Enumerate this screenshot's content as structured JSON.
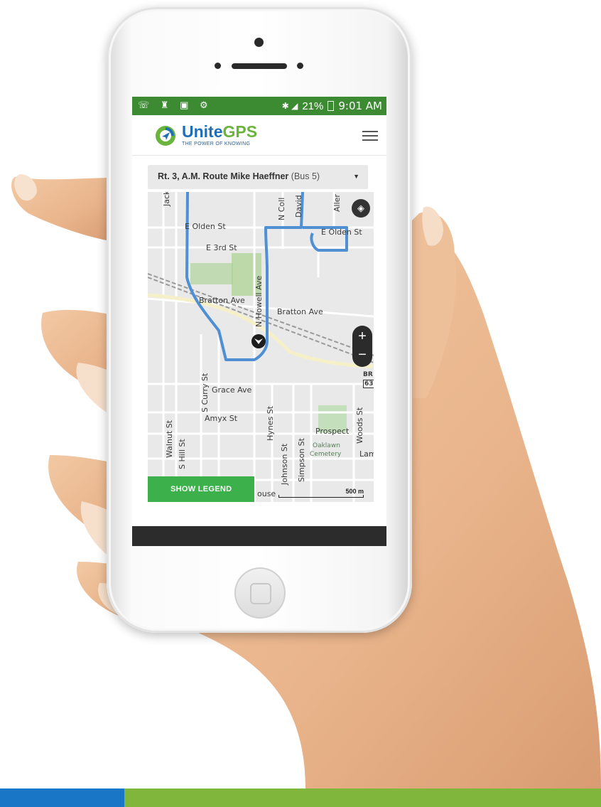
{
  "status_bar": {
    "battery": "21%",
    "time": "9:01 AM"
  },
  "header": {
    "logo_unite": "Unite",
    "logo_gps": "GPS",
    "tagline": "THE POWER OF KNOWING"
  },
  "route_selector": {
    "selected_route": "Rt. 3, A.M. Route Mike Haeffner",
    "selected_bus": "(Bus 5)"
  },
  "map": {
    "streets": {
      "e_olden_st_w": "E Olden St",
      "e_olden_st_e": "E Olden St",
      "e_3rd_st": "E 3rd St",
      "bratton_ave_w": "Bratton Ave",
      "bratton_ave_e": "Bratton Ave",
      "grace_ave": "Grace Ave",
      "amyx_st": "Amyx St",
      "prospect": "Prospect",
      "oaklawn": "Oaklawn",
      "cemetery": "Cemetery",
      "jackson": "Jackson",
      "n_coll": "N Coll",
      "david": "David",
      "aller": "Aller",
      "s_curry_st": "S Curry St",
      "walnut_st": "Walnut St",
      "s_hill_st": "S Hill St",
      "hynes_st": "Hynes St",
      "johnson_st": "Johnson St",
      "simpson_st": "Simpson St",
      "woods_st": "Woods St",
      "n_howell_ave": "N Howell Ave",
      "lam": "Lam",
      "br": "BR",
      "hwy_63": "63",
      "house": "ouse"
    },
    "zoom_in": "+",
    "zoom_out": "−",
    "scale_label": "500 m",
    "legend_button": "SHOW LEGEND",
    "route_color": "#4f8fd4"
  },
  "brand_colors": {
    "blue": "#1976c6",
    "green": "#7fb63b",
    "status_green": "#3c8a32"
  }
}
